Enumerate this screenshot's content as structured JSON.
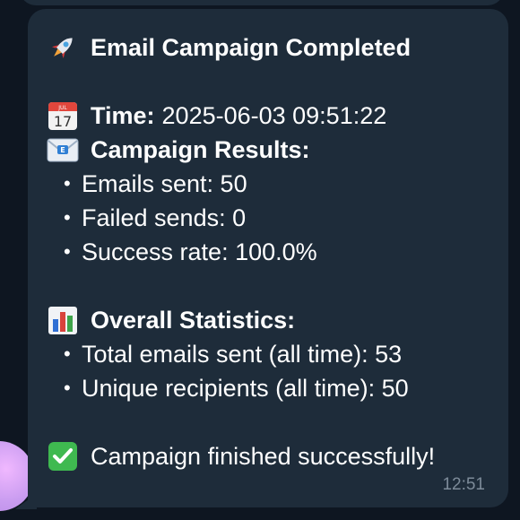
{
  "message": {
    "title": "Email Campaign Completed",
    "time_label": "Time:",
    "time_value": "2025-06-03 09:51:22",
    "calendar_month": "JUL",
    "calendar_day": "17",
    "results_heading": "Campaign Results:",
    "results": [
      "Emails sent: 50",
      "Failed sends: 0",
      "Success rate: 100.0%"
    ],
    "stats_heading": "Overall Statistics:",
    "stats": [
      "Total emails sent (all time): 53",
      "Unique recipients (all time): 50"
    ],
    "footer": "Campaign finished successfully!",
    "timestamp": "12:51"
  },
  "icons": {
    "title": "rocket-icon",
    "time": "calendar-icon",
    "results": "email-icon",
    "stats": "bar-chart-icon",
    "footer": "check-mark-icon"
  },
  "colors": {
    "background": "#0e1621",
    "bubble": "#1e2c3a",
    "text": "#ffffff",
    "timestamp": "#7d8b99",
    "check_green": "#3fb950"
  }
}
